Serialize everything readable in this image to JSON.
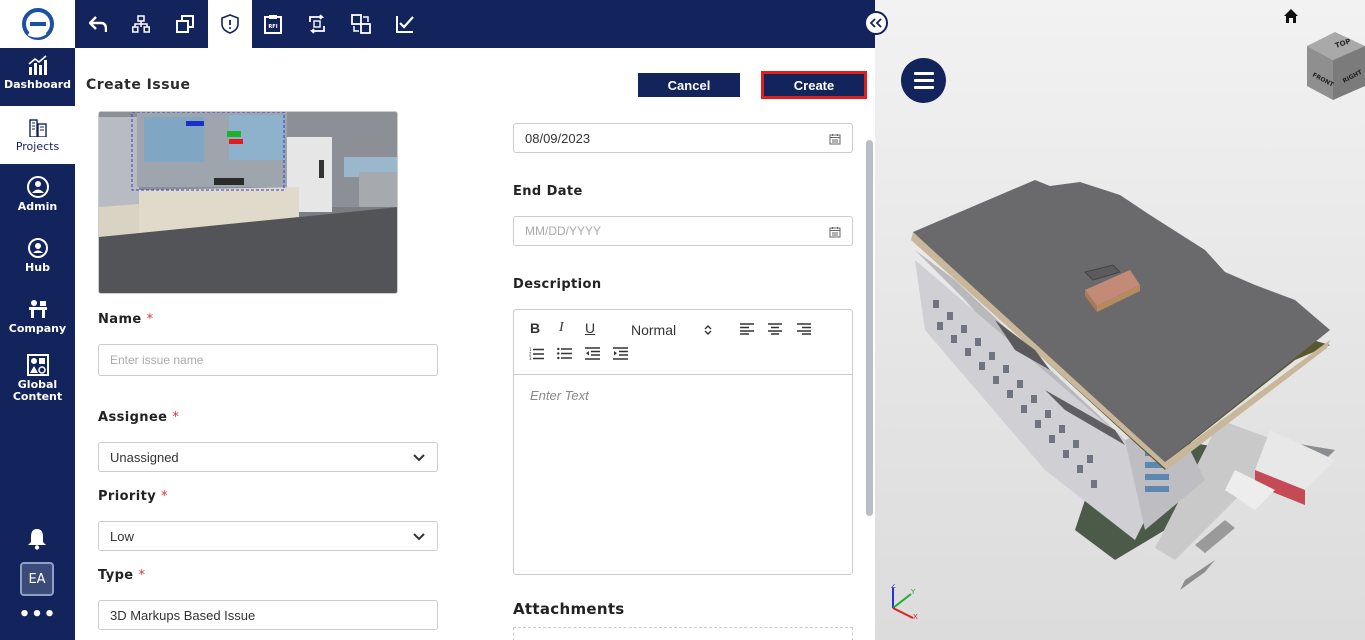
{
  "nav": {
    "items": [
      {
        "label": "Dashboard"
      },
      {
        "label": "Projects"
      },
      {
        "label": "Admin"
      },
      {
        "label": "Hub"
      },
      {
        "label": "Company"
      },
      {
        "label": "Global Content"
      }
    ],
    "avatar": "EA",
    "more": "•••"
  },
  "panel": {
    "title": "Create Issue",
    "cancel_label": "Cancel",
    "create_label": "Create"
  },
  "form": {
    "name_label": "Name",
    "name_placeholder": "Enter issue name",
    "assignee_label": "Assignee",
    "assignee_value": "Unassigned",
    "priority_label": "Priority",
    "priority_value": "Low",
    "type_label": "Type",
    "type_value": "3D Markups Based Issue",
    "required_mark": "*",
    "start_date_value": "08/09/2023",
    "end_date_label": "End Date",
    "end_date_placeholder": "MM/DD/YYYY",
    "description_label": "Description",
    "editor_style": "Normal",
    "editor_placeholder": "Enter Text",
    "attachments_label": "Attachments"
  },
  "colors": {
    "navy": "#13235b",
    "required": "#e03030",
    "create_outline": "#e01e1e"
  }
}
